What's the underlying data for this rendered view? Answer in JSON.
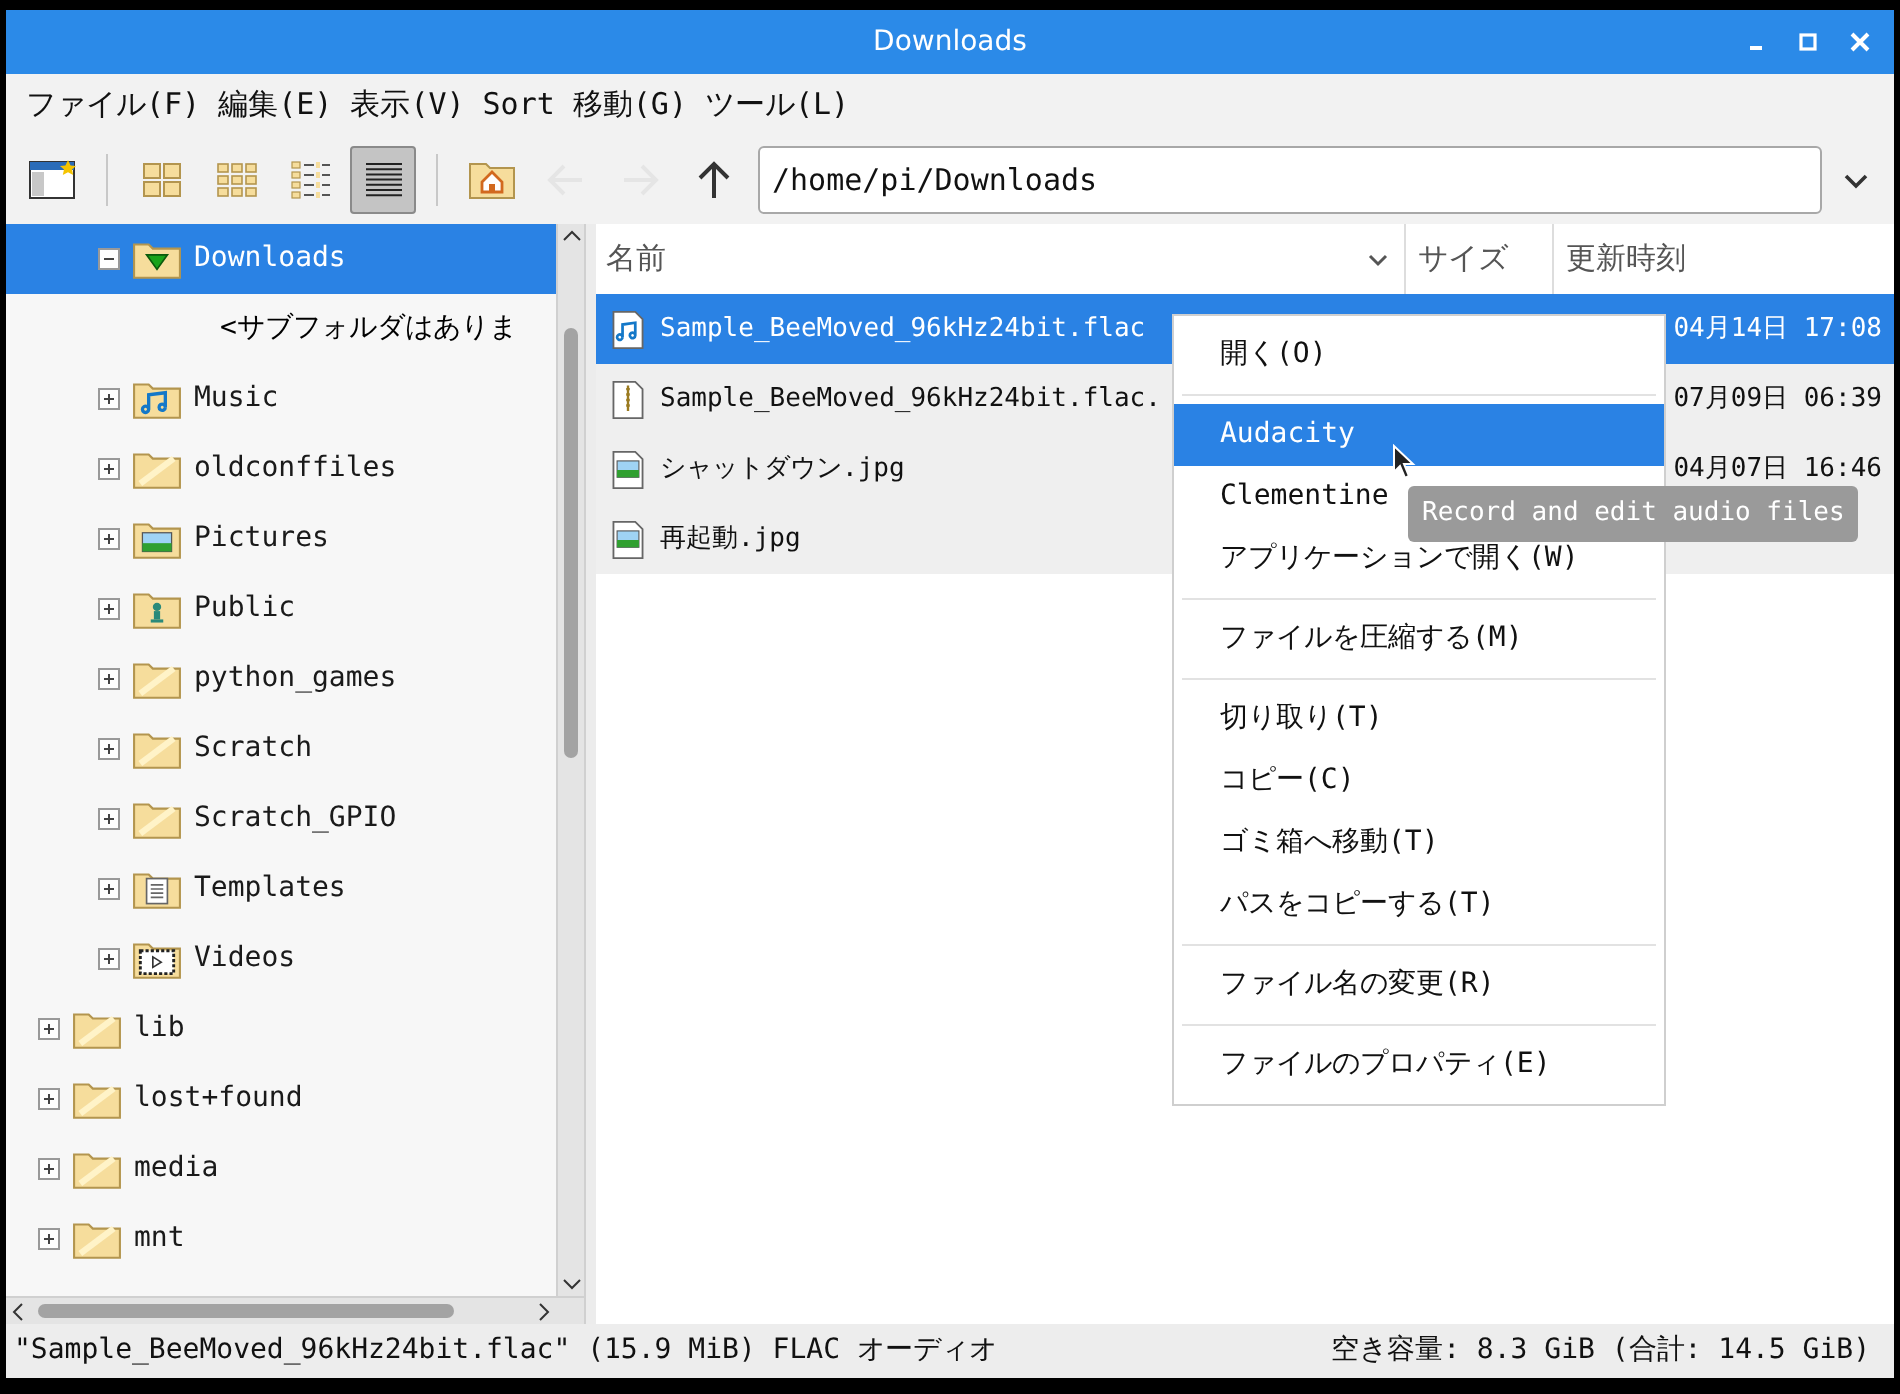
{
  "window": {
    "title": "Downloads"
  },
  "menu_bar": [
    "ファイル(F)",
    "編集(E)",
    "表示(V)",
    "Sort",
    "移動(G)",
    "ツール(L)"
  ],
  "toolbar": {
    "view_buttons": [
      {
        "kind": "icons",
        "selected": false
      },
      {
        "kind": "thumbnails",
        "selected": false
      },
      {
        "kind": "compact",
        "selected": false
      },
      {
        "kind": "detailed",
        "selected": true
      }
    ],
    "nav_buttons": [
      {
        "kind": "home",
        "disabled": false
      },
      {
        "kind": "back",
        "disabled": true
      },
      {
        "kind": "forward",
        "disabled": true
      },
      {
        "kind": "up",
        "disabled": false
      }
    ],
    "path": "/home/pi/Downloads"
  },
  "tree": {
    "home_children": [
      {
        "label": "Downloads",
        "kind": "downloads",
        "expanded": true,
        "selected": true,
        "children": [
          {
            "label": "<サブフォルダはありま"
          }
        ]
      },
      {
        "label": "Music",
        "kind": "music",
        "expanded": false,
        "selected": false
      },
      {
        "label": "oldconffiles",
        "kind": "plain",
        "expanded": false,
        "selected": false
      },
      {
        "label": "Pictures",
        "kind": "pictures",
        "expanded": false,
        "selected": false
      },
      {
        "label": "Public",
        "kind": "public",
        "expanded": false,
        "selected": false
      },
      {
        "label": "python_games",
        "kind": "plain",
        "expanded": false,
        "selected": false
      },
      {
        "label": "Scratch",
        "kind": "plain",
        "expanded": false,
        "selected": false
      },
      {
        "label": "Scratch_GPIO",
        "kind": "plain",
        "expanded": false,
        "selected": false
      },
      {
        "label": "Templates",
        "kind": "templates",
        "expanded": false,
        "selected": false
      },
      {
        "label": "Videos",
        "kind": "videos",
        "expanded": false,
        "selected": false
      }
    ],
    "root_items": [
      {
        "label": "lib",
        "kind": "plain",
        "expanded": false,
        "selected": false
      },
      {
        "label": "lost+found",
        "kind": "plain",
        "expanded": false,
        "selected": false
      },
      {
        "label": "media",
        "kind": "plain",
        "expanded": false,
        "selected": false
      },
      {
        "label": "mnt",
        "kind": "plain",
        "expanded": false,
        "selected": false
      }
    ]
  },
  "file_list": {
    "columns": [
      "名前",
      "サイズ",
      "更新時刻"
    ],
    "rows": [
      {
        "name": "Sample_BeeMoved_96kHz24bit.flac",
        "kind": "audio",
        "modified": "04月14日 17:08",
        "selected": true
      },
      {
        "name": "Sample_BeeMoved_96kHz24bit.flac.",
        "kind": "archive",
        "modified": "07月09日 06:39",
        "selected": false
      },
      {
        "name": "シャットダウン.jpg",
        "kind": "image",
        "modified": "04月07日 16:46",
        "selected": false
      },
      {
        "name": "再起動.jpg",
        "kind": "image",
        "selected": false
      }
    ]
  },
  "context_menu": {
    "groups": [
      [
        {
          "label": "開く(O)",
          "selected": false
        }
      ],
      [
        {
          "label": "Audacity",
          "selected": true
        },
        {
          "label": "Clementine",
          "selected": false
        },
        {
          "label": "アプリケーションで開く(W)",
          "selected": false
        }
      ],
      [
        {
          "label": "ファイルを圧縮する(M)",
          "selected": false
        }
      ],
      [
        {
          "label": "切り取り(T)",
          "selected": false
        },
        {
          "label": "コピー(C)",
          "selected": false
        },
        {
          "label": "ゴミ箱へ移動(T)",
          "selected": false
        },
        {
          "label": "パスをコピーする(T)",
          "selected": false
        }
      ],
      [
        {
          "label": "ファイル名の変更(R)",
          "selected": false
        }
      ],
      [
        {
          "label": "ファイルのプロパティ(E)",
          "selected": false
        }
      ]
    ]
  },
  "tooltip": "Record and edit audio files",
  "status_bar": {
    "selection": "\"Sample_BeeMoved_96kHz24bit.flac\" (15.9 MiB) FLAC オーディオ",
    "free_space": "空き容量: 8.3 GiB (合計: 14.5 GiB)"
  }
}
